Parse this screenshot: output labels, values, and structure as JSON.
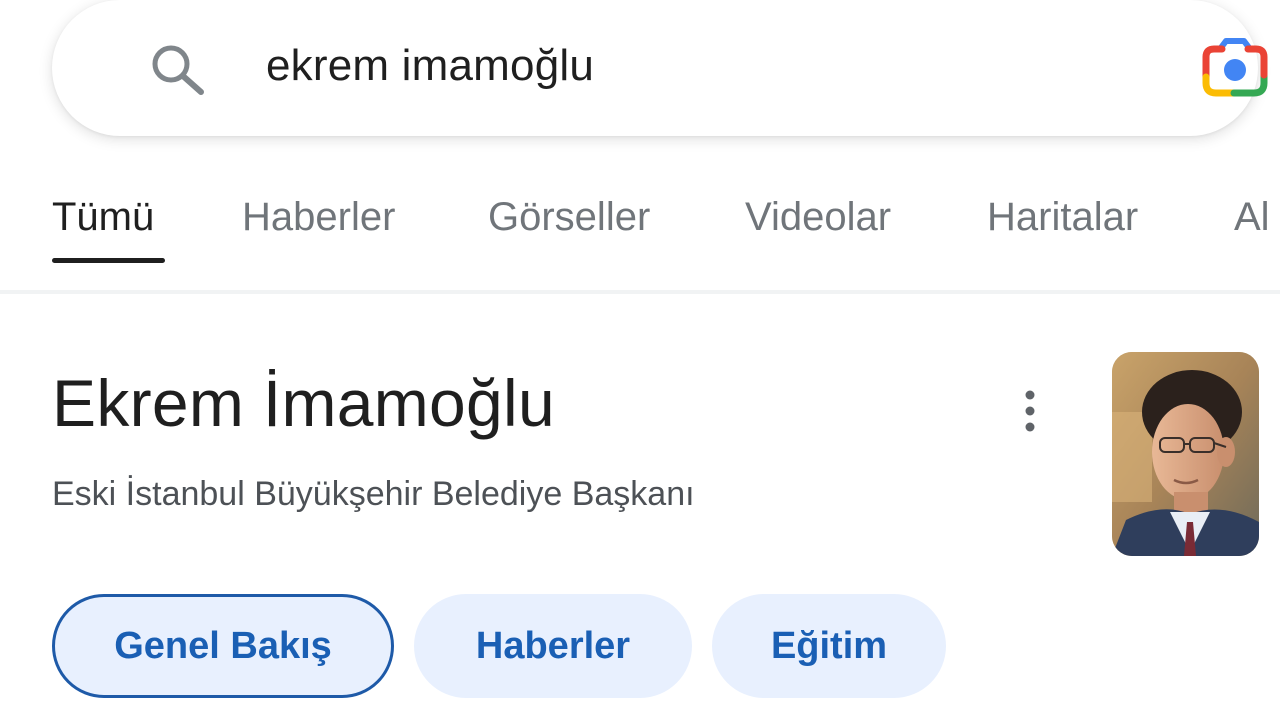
{
  "search": {
    "query": "ekrem imamoğlu"
  },
  "tabs": [
    {
      "label": "Tümü",
      "active": true
    },
    {
      "label": "Haberler"
    },
    {
      "label": "Görseller"
    },
    {
      "label": "Videolar"
    },
    {
      "label": "Haritalar"
    },
    {
      "label": "Al"
    }
  ],
  "knowledge_panel": {
    "title": "Ekrem İmamoğlu",
    "subtitle": "Eski İstanbul Büyükşehir Belediye Başkanı"
  },
  "chips": [
    {
      "label": "Genel Bakış",
      "selected": true
    },
    {
      "label": "Haberler"
    },
    {
      "label": "Eğitim"
    }
  ],
  "colors": {
    "accent_text": "#1a5fb4",
    "chip_bg": "#e8f0fe",
    "tab_inactive": "#70757a"
  },
  "icons": [
    "search-icon",
    "google-lens-icon",
    "more-vert-icon"
  ]
}
